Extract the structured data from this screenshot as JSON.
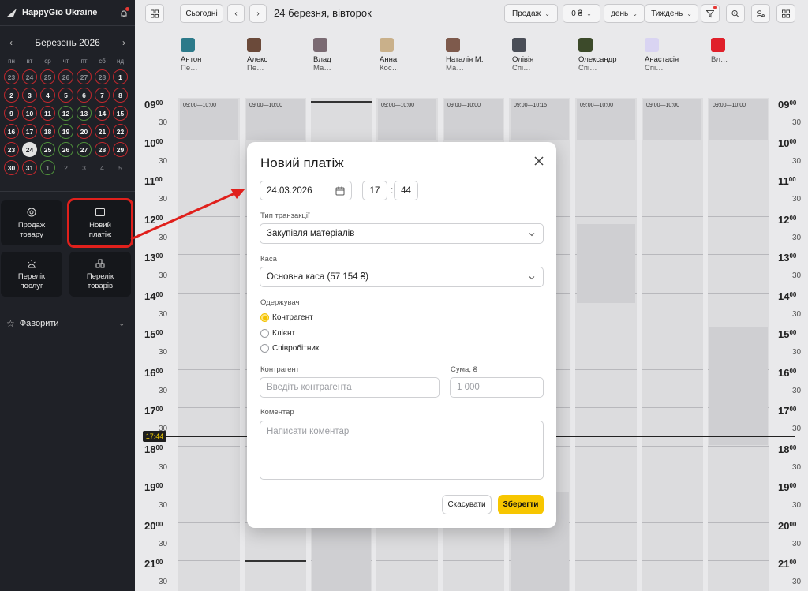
{
  "app": {
    "name": "HappyGio Ukraine"
  },
  "calendar": {
    "month_title": "Березень 2026",
    "weekdays": [
      "пн",
      "вт",
      "ср",
      "чт",
      "пт",
      "сб",
      "нд"
    ],
    "days": [
      {
        "d": "23",
        "s": "red dim"
      },
      {
        "d": "24",
        "s": "red dim"
      },
      {
        "d": "25",
        "s": "red dim"
      },
      {
        "d": "26",
        "s": "red dim"
      },
      {
        "d": "27",
        "s": "red dim"
      },
      {
        "d": "28",
        "s": "red dim"
      },
      {
        "d": "1",
        "s": "red"
      },
      {
        "d": "2",
        "s": "red"
      },
      {
        "d": "3",
        "s": "red"
      },
      {
        "d": "4",
        "s": "red"
      },
      {
        "d": "5",
        "s": "red"
      },
      {
        "d": "6",
        "s": "red"
      },
      {
        "d": "7",
        "s": "red"
      },
      {
        "d": "8",
        "s": "red"
      },
      {
        "d": "9",
        "s": "red"
      },
      {
        "d": "10",
        "s": "red"
      },
      {
        "d": "11",
        "s": "red"
      },
      {
        "d": "12",
        "s": "green"
      },
      {
        "d": "13",
        "s": "green"
      },
      {
        "d": "14",
        "s": "red"
      },
      {
        "d": "15",
        "s": "red"
      },
      {
        "d": "16",
        "s": "red"
      },
      {
        "d": "17",
        "s": "red"
      },
      {
        "d": "18",
        "s": "red"
      },
      {
        "d": "19",
        "s": "green"
      },
      {
        "d": "20",
        "s": "red"
      },
      {
        "d": "21",
        "s": "red"
      },
      {
        "d": "22",
        "s": "red"
      },
      {
        "d": "23",
        "s": "red"
      },
      {
        "d": "24",
        "s": "today"
      },
      {
        "d": "25",
        "s": "green"
      },
      {
        "d": "26",
        "s": "green"
      },
      {
        "d": "27",
        "s": "green"
      },
      {
        "d": "28",
        "s": "red"
      },
      {
        "d": "29",
        "s": "red"
      },
      {
        "d": "30",
        "s": "red"
      },
      {
        "d": "31",
        "s": "red"
      },
      {
        "d": "1",
        "s": "green dim"
      },
      {
        "d": "2",
        "s": "plain"
      },
      {
        "d": "3",
        "s": "plain"
      },
      {
        "d": "4",
        "s": "plain"
      },
      {
        "d": "5",
        "s": "plain"
      }
    ]
  },
  "tiles": [
    {
      "label": "Продаж\nтовару",
      "icon": "target-icon",
      "name": "tile-product-sale"
    },
    {
      "label": "Новий\nплатіж",
      "icon": "payment-icon",
      "name": "tile-new-payment"
    },
    {
      "label": "Перелік\nпослуг",
      "icon": "services-icon",
      "name": "tile-services-list"
    },
    {
      "label": "Перелік\nтоварів",
      "icon": "products-icon",
      "name": "tile-products-list"
    }
  ],
  "favorites": {
    "label": "Фаворити"
  },
  "topbar": {
    "today": "Сьогодні",
    "date_title": "24 березня, вівторок",
    "sales": "Продаж",
    "amount": "0 ₴",
    "unit": "день",
    "period": "Тиждень"
  },
  "staff": [
    {
      "name": "Антон",
      "role": "Перукар",
      "color": "#2c7a8a"
    },
    {
      "name": "Алекс",
      "role": "Перукар",
      "color": "#6b4a3a"
    },
    {
      "name": "Влад",
      "role": "Масажист",
      "color": "#7a6a72"
    },
    {
      "name": "Анна",
      "role": "Косметолог",
      "color": "#c9b08a"
    },
    {
      "name": "Наталія М.",
      "role": "Майстер мані...",
      "color": "#7e5a4c"
    },
    {
      "name": "Олівія",
      "role": "Співробітник ...",
      "color": "#4a4e57"
    },
    {
      "name": "Олександр",
      "role": "Співробітник ...",
      "color": "#3c4a2a"
    },
    {
      "name": "Анастасія",
      "role": "Співробітник ...",
      "color": "#d9d4f2"
    },
    {
      "name": "",
      "role": "Владелец",
      "color": "#e0202a"
    }
  ],
  "grid": {
    "hours": [
      "09",
      "10",
      "11",
      "12",
      "13",
      "14",
      "15",
      "16",
      "17",
      "18",
      "19",
      "20",
      "21"
    ],
    "minutes_label": "00",
    "half_label": "30",
    "slot_labels": [
      "09:00—10:00",
      "09:00—10:00",
      "",
      "09:00—10:00",
      "09:00—10:00",
      "09:00—10:15",
      "09:00—10:00",
      "09:00—10:00",
      "09:00—10:00"
    ],
    "now": "17:44"
  },
  "dialog": {
    "title": "Новий платіж",
    "date": "24.03.2026",
    "hour": "17",
    "minute": "44",
    "time_sep": ":",
    "transaction_label": "Тип транзакції",
    "transaction_value": "Закупівля матеріалів",
    "cash_label": "Каса",
    "cash_value": "Основна каса (57 154 ₴)",
    "recipient_label": "Одержувач",
    "recipients": [
      "Контрагент",
      "Клієнт",
      "Співробітник"
    ],
    "selected_recipient": 0,
    "counterparty_label": "Контрагент",
    "counterparty_placeholder": "Введіть контрагента",
    "sum_label": "Сума, ₴",
    "sum_placeholder": "1 000",
    "comment_label": "Коментар",
    "comment_placeholder": "Написати коментар",
    "cancel": "Скасувати",
    "save": "Зберегти"
  },
  "colors": {
    "accent": "#f7c600",
    "annotation": "#e0201c",
    "sidebar": "#1f2127"
  }
}
